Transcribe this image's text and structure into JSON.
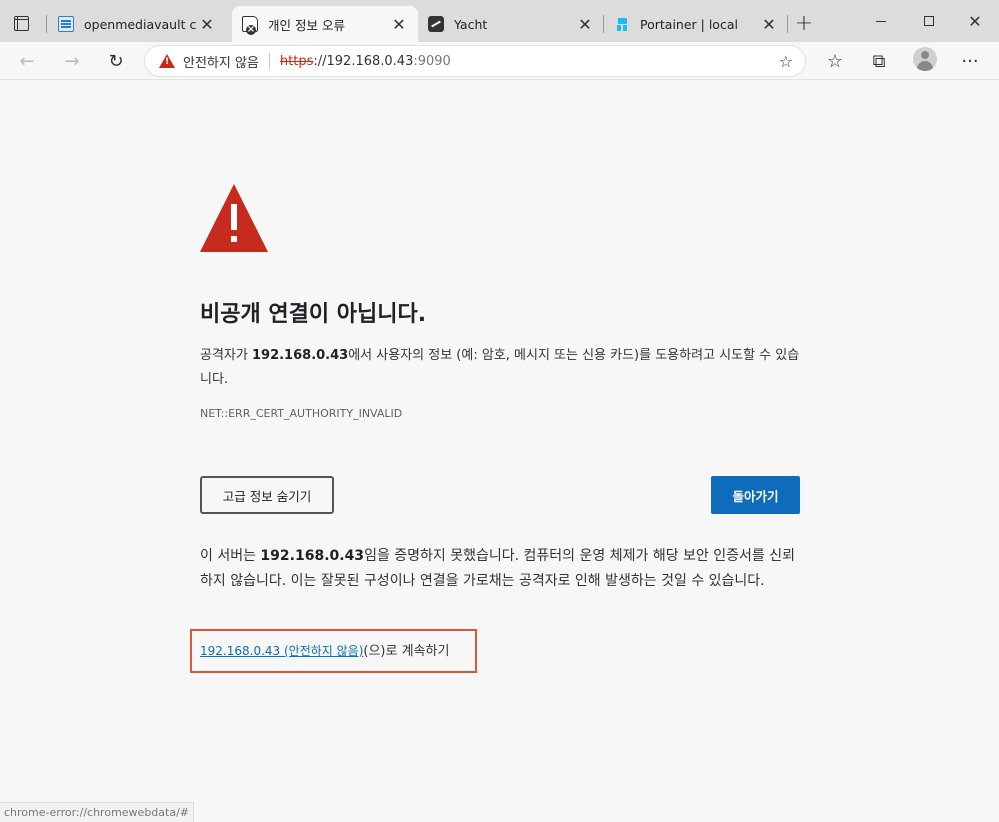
{
  "tabs": [
    {
      "title": "openmediavault contro",
      "favicon": "openmediavault-icon",
      "active": false
    },
    {
      "title": "개인 정보 오류",
      "favicon": "page-error-icon",
      "active": true
    },
    {
      "title": "Yacht",
      "favicon": "yacht-icon",
      "active": false
    },
    {
      "title": "Portainer | local",
      "favicon": "portainer-icon",
      "active": false
    }
  ],
  "address_bar": {
    "security_label": "안전하지 않음",
    "scheme": "https",
    "host": "://192.168.0.43",
    "port": ":9090"
  },
  "page": {
    "heading": "비공개 연결이 아닙니다.",
    "desc_prefix": "공격자가 ",
    "desc_host": "192.168.0.43",
    "desc_suffix": "에서 사용자의 정보 (예: 암호, 메시지 또는 신용 카드)를 도용하려고 시도할 수 있습니다.",
    "error_code": "NET::ERR_CERT_AUTHORITY_INVALID",
    "advanced_button": "고급 정보 숨기기",
    "back_button": "돌아가기",
    "detail_prefix": "이 서버는 ",
    "detail_host": "192.168.0.43",
    "detail_suffix": "임을 증명하지 못했습니다. 컴퓨터의 운영 체제가 해당 보안 인증서를 신뢰하지 않습니다. 이는 잘못된 구성이나 연결을 가로채는 공격자로 인해 발생하는 것일 수 있습니다.",
    "proceed_link": "192.168.0.43 (안전하지 않음)",
    "proceed_suffix": "(으)로 계속하기"
  },
  "status_bar": "chrome-error://chromewebdata/#",
  "colors": {
    "accent_blue": "#0f6cbd",
    "warning_red": "#c42b1c",
    "highlight_box": "#d9573a"
  }
}
